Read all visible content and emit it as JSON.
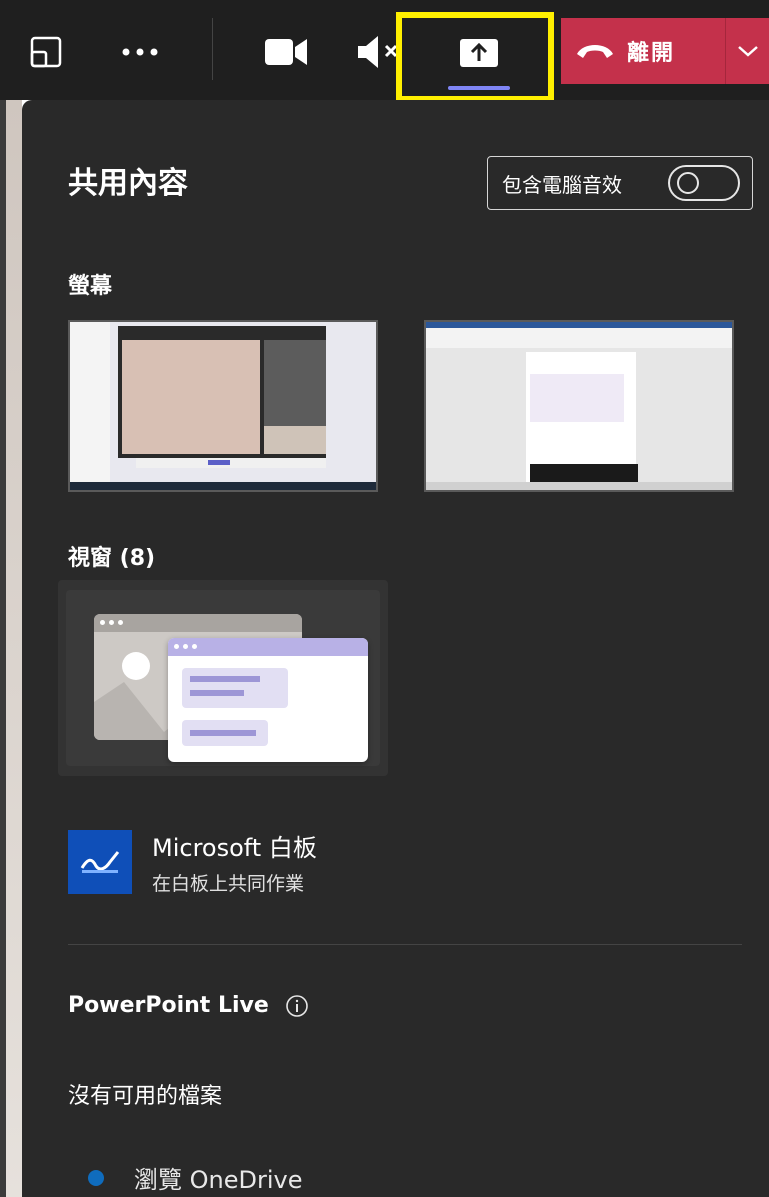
{
  "toolbar": {
    "leave_label": "離開",
    "colors": {
      "background": "#1f1f1f",
      "leave": "#c4314b",
      "highlight": "#ffef00",
      "accent": "#7f85f5"
    },
    "icons": [
      "cast-icon",
      "more-icon",
      "video-camera-icon",
      "speaker-muted-icon",
      "share-screen-icon",
      "hang-up-icon",
      "chevron-down-icon"
    ]
  },
  "panel": {
    "title": "共用內容",
    "include_audio_label": "包含電腦音效",
    "include_audio_on": false,
    "screens_label": "螢幕",
    "windows_label": "視窗 (8)",
    "whiteboard": {
      "title": "Microsoft 白板",
      "subtitle": "在白板上共同作業"
    },
    "powerpoint_label": "PowerPoint Live",
    "no_files_label": "沒有可用的檔案",
    "onedrive_label": "瀏覽 OneDrive"
  }
}
